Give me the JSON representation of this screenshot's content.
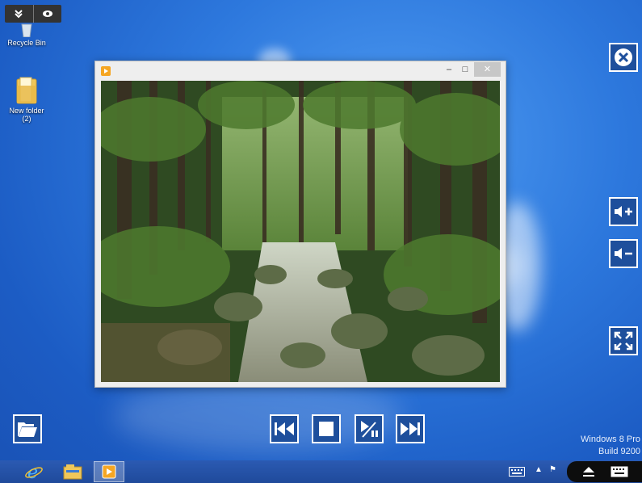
{
  "desktop": {
    "icons": [
      {
        "label": "Recycle Bin",
        "icon": "recycle-bin-icon"
      },
      {
        "label": "New folder",
        "sub": "(2)",
        "icon": "folder-icon"
      }
    ],
    "watermark": {
      "line1": "Windows 8 Pro",
      "line2": "Build 9200"
    }
  },
  "topbar": {
    "buttons": [
      "collapse-icon",
      "eye-icon"
    ]
  },
  "window": {
    "title": "",
    "controls": {
      "minimize": "–",
      "maximize": "□",
      "close": "✕"
    },
    "photo_description_icon": "forest-stream-photo"
  },
  "controls": {
    "close": "close-icon",
    "volume_up": "volume-up-icon",
    "volume_down": "volume-down-icon",
    "fullscreen": "fullscreen-icon",
    "open": "open-folder-icon",
    "previous": "previous-icon",
    "stop": "stop-icon",
    "play_pause": "play-pause-icon",
    "next": "next-icon"
  },
  "taskbar": {
    "apps": [
      "internet-explorer-icon",
      "file-explorer-icon",
      "media-player-icon"
    ]
  },
  "colors": {
    "accent": "#1e4f9c",
    "taskbar": "#2252a8"
  }
}
